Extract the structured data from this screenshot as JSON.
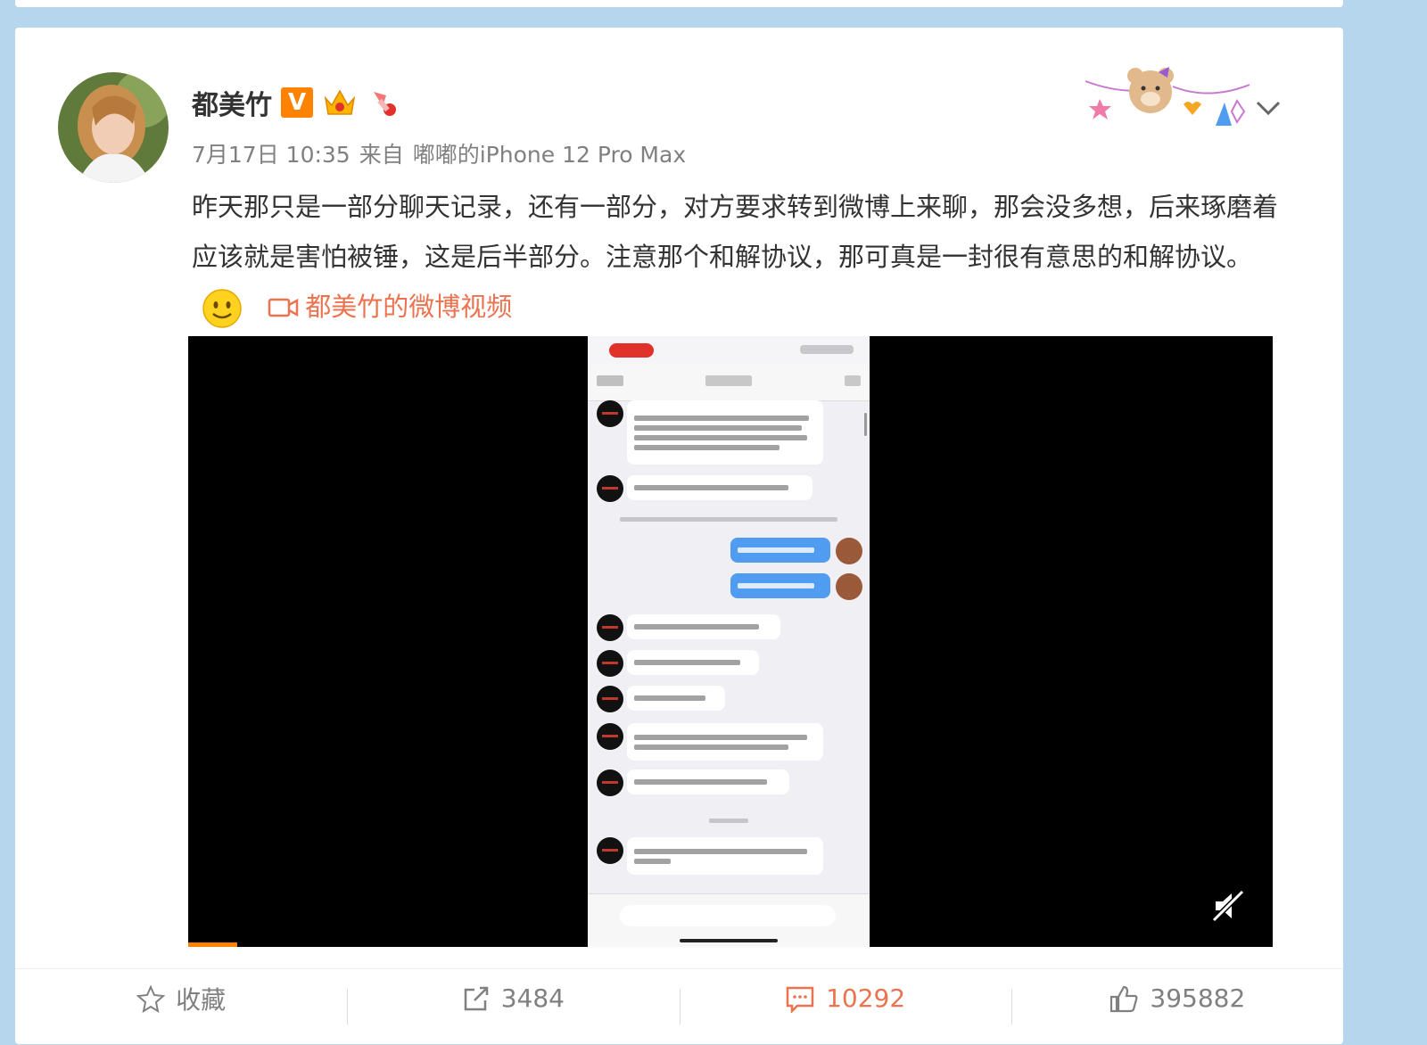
{
  "post": {
    "author": "都美竹",
    "verified_badge": "V",
    "time": "7月17日 10:35",
    "source_prefix": "来自",
    "source": "嘟嘟的iPhone 12 Pro Max",
    "text": "昨天那只是一部分聊天记录，还有一部分，对方要求转到微博上来聊，那会没多想，后来琢磨着应该就是害怕被锤，这是后半部分。注意那个和解协议，那可真是一封很有意思的和解协议。",
    "video_link_label": "都美竹的微博视频",
    "video_progress": 0.045
  },
  "actions": {
    "favorite_label": "收藏",
    "repost_count": "3484",
    "comment_count": "10292",
    "like_count": "395882"
  },
  "colors": {
    "page_bg": "#b6d6ee",
    "accent_orange": "#ff8200",
    "link_orange": "#eb7350",
    "text_main": "#333333",
    "text_meta": "#808080"
  },
  "icons": [
    "verified-v-icon",
    "crown-icon",
    "pin-icon",
    "sticker-decoration",
    "chevron-down-icon",
    "smile-emoji-icon",
    "video-camera-icon",
    "mute-icon",
    "star-icon",
    "repost-icon",
    "comment-icon",
    "thumbs-up-icon"
  ]
}
